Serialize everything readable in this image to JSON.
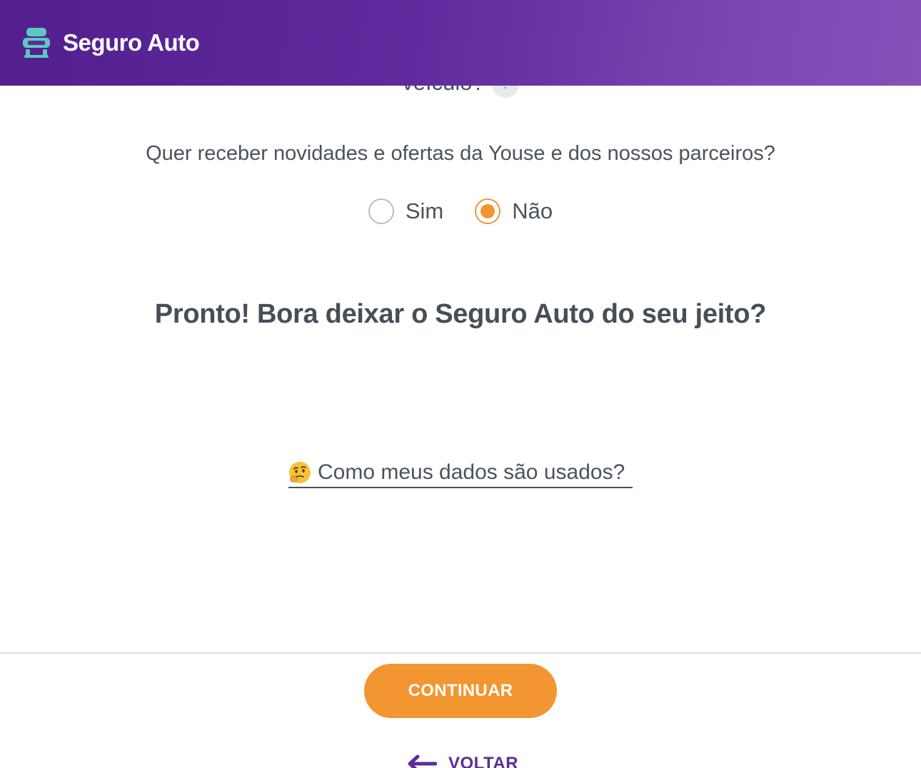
{
  "header": {
    "logo_icon": "car-seat-icon",
    "title": "Seguro Auto",
    "gradient_start": "#531f8f",
    "gradient_end": "#8650b8"
  },
  "previous_question": {
    "text_fragment": "veículo?",
    "help_symbol": "?"
  },
  "newsletter": {
    "question": "Quer receber novidades e ofertas da Youse e dos nossos parceiros?",
    "options": [
      {
        "label": "Sim",
        "selected": false
      },
      {
        "label": "Não",
        "selected": true
      }
    ],
    "accent_color": "#f39530"
  },
  "heading": "Pronto! Bora deixar o Seguro Auto do seu jeito?",
  "data_usage_link": {
    "icon": "thinking-face-icon",
    "label": "Como meus dados são usados?"
  },
  "footer": {
    "continue_label": "CONTINUAR",
    "back_icon": "arrow-left-icon",
    "back_label": "VOLTAR",
    "continue_color": "#f39530",
    "back_color": "#5c2d92"
  }
}
